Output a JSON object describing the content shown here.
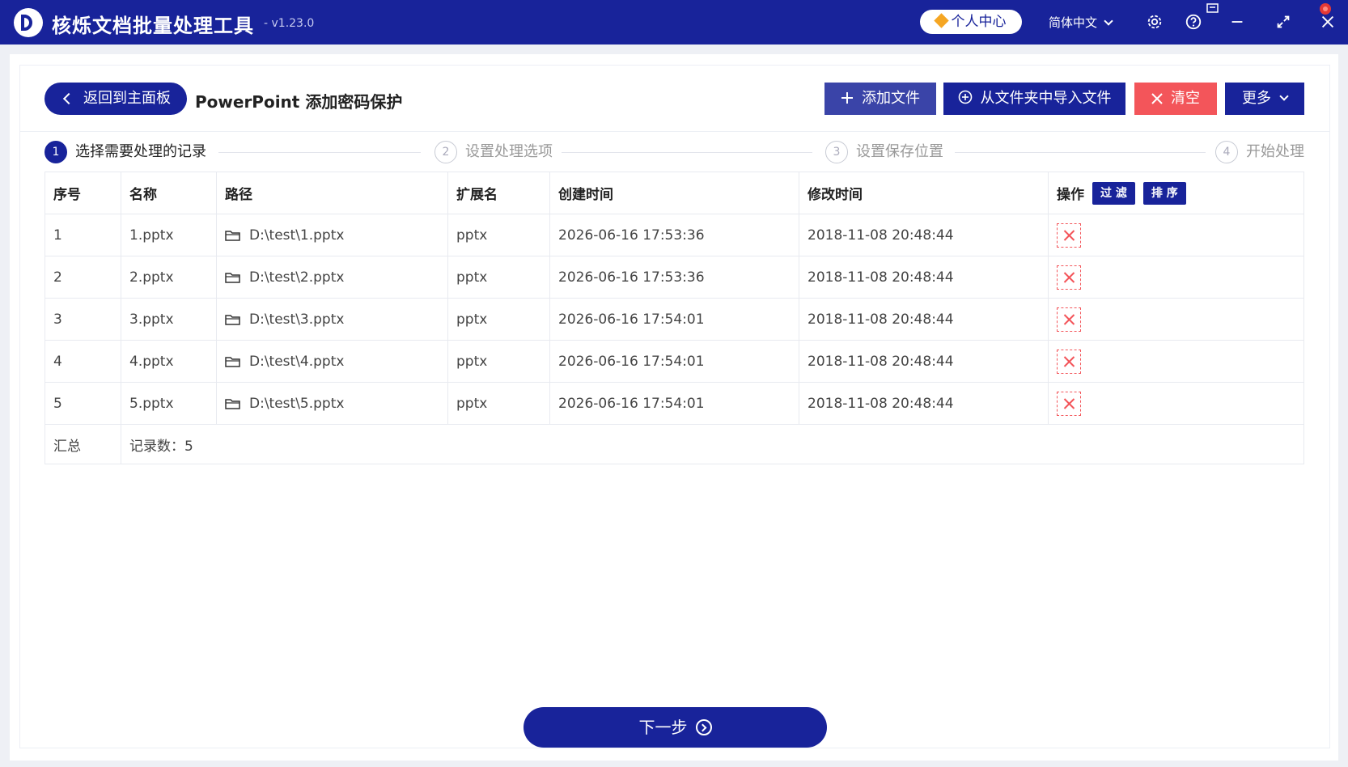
{
  "app": {
    "title": "核烁文档批量处理工具",
    "version": "- v1.23.0",
    "user_center": "个人中心",
    "language": "简体中文"
  },
  "toolbar": {
    "back_label": "返回到主面板",
    "page_title": "PowerPoint 添加密码保护",
    "add_file": "添加文件",
    "import_folder": "从文件夹中导入文件",
    "clear": "清空",
    "more": "更多"
  },
  "steps": [
    {
      "num": "1",
      "label": "选择需要处理的记录"
    },
    {
      "num": "2",
      "label": "设置处理选项"
    },
    {
      "num": "3",
      "label": "设置保存位置"
    },
    {
      "num": "4",
      "label": "开始处理"
    }
  ],
  "table": {
    "headers": [
      "序号",
      "名称",
      "路径",
      "扩展名",
      "创建时间",
      "修改时间",
      "操作"
    ],
    "filter_label": "过 滤",
    "sort_label": "排 序",
    "rows": [
      {
        "index": "1",
        "name": "1.pptx",
        "path": "D:\\test\\1.pptx",
        "ext": "pptx",
        "created": "2026-06-16 17:53:36",
        "modified": "2018-11-08 20:48:44"
      },
      {
        "index": "2",
        "name": "2.pptx",
        "path": "D:\\test\\2.pptx",
        "ext": "pptx",
        "created": "2026-06-16 17:53:36",
        "modified": "2018-11-08 20:48:44"
      },
      {
        "index": "3",
        "name": "3.pptx",
        "path": "D:\\test\\3.pptx",
        "ext": "pptx",
        "created": "2026-06-16 17:54:01",
        "modified": "2018-11-08 20:48:44"
      },
      {
        "index": "4",
        "name": "4.pptx",
        "path": "D:\\test\\4.pptx",
        "ext": "pptx",
        "created": "2026-06-16 17:54:01",
        "modified": "2018-11-08 20:48:44"
      },
      {
        "index": "5",
        "name": "5.pptx",
        "path": "D:\\test\\5.pptx",
        "ext": "pptx",
        "created": "2026-06-16 17:54:01",
        "modified": "2018-11-08 20:48:44"
      }
    ],
    "summary_label": "汇总",
    "summary_value": "记录数：5"
  },
  "next_button": "下一步",
  "colors": {
    "primary": "#18239a",
    "danger": "#f3555a",
    "secondary": "#3a44a8"
  },
  "icons": [
    "app-logo-icon",
    "diamond-icon",
    "gear-icon",
    "help-icon",
    "minimize-icon",
    "maximize-icon",
    "close-icon",
    "plus-icon",
    "plus-circle-icon",
    "x-icon",
    "chevron-down-icon",
    "folder-icon",
    "delete-icon",
    "arrow-circle-icon"
  ]
}
